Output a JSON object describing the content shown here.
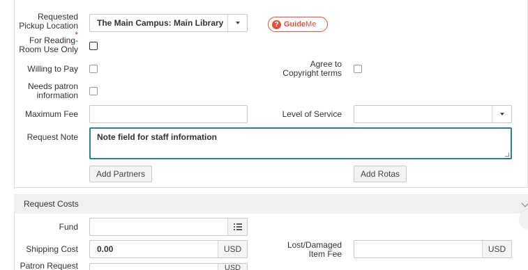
{
  "request": {
    "pickup_label_1": "Requested",
    "pickup_label_2": "Pickup Location",
    "pickup_required": "*",
    "pickup_value": "The Main Campus: Main Library",
    "guideme_bold": "Guide",
    "guideme_light": "Me",
    "reading_label_1": "For Reading-",
    "reading_label_2": "Room Use Only",
    "willing_label": "Willing to Pay",
    "agree_label_1": "Agree to",
    "agree_label_2": "Copyright terms",
    "needs_label_1": "Needs patron",
    "needs_label_2": "information",
    "max_fee_label": "Maximum Fee",
    "max_fee_value": "",
    "level_label": "Level of Service",
    "level_value": "",
    "note_label": "Request Note",
    "note_value": "Note field for staff information",
    "add_partners": "Add Partners",
    "add_rotas": "Add Rotas"
  },
  "costs": {
    "section_title": "Request Costs",
    "fund_label": "Fund",
    "fund_value": "",
    "shipping_label": "Shipping Cost",
    "shipping_value": "0.00",
    "shipping_currency": "USD",
    "lost_label_1": "Lost/Damaged",
    "lost_label_2": "Item Fee",
    "lost_value": "",
    "lost_currency": "USD",
    "patron_label": "Patron Request",
    "patron_currency": "USD"
  },
  "icons": {
    "pickup_caret": "chevron-down-icon",
    "level_caret": "chevron-down-icon",
    "fund_list": "list-icon",
    "section_toggle": "chevron-down-icon",
    "guideme": "question-icon"
  },
  "colors": {
    "accent_focus": "#2f7d92",
    "guideme": "#e0503a",
    "required": "#c0392b"
  }
}
